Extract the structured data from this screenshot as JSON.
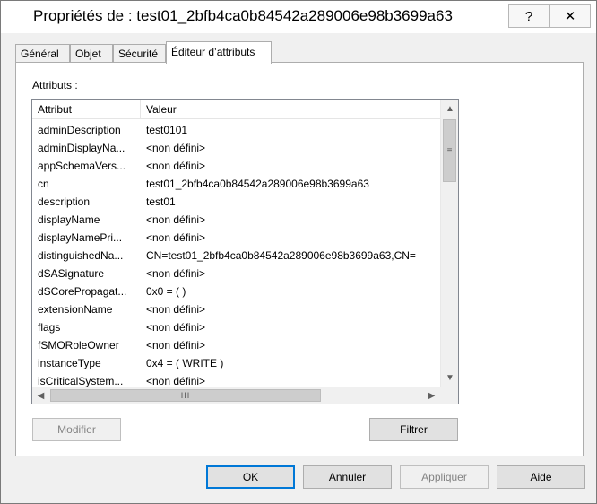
{
  "window": {
    "title": "Propriétés de : test01_2bfb4ca0b84542a289006e98b3699a63",
    "help_label": "?",
    "close_label": "✕"
  },
  "tabs": [
    {
      "label": "Général"
    },
    {
      "label": "Objet"
    },
    {
      "label": "Sécurité"
    },
    {
      "label": "Éditeur d’attributs",
      "active": true
    }
  ],
  "attributes": {
    "label": "Attributs :",
    "columns": [
      "Attribut",
      "Valeur"
    ],
    "rows": [
      {
        "name": "adminDescription",
        "value": "test0101"
      },
      {
        "name": "adminDisplayNa...",
        "value": "<non défini>"
      },
      {
        "name": "appSchemaVers...",
        "value": "<non défini>"
      },
      {
        "name": "cn",
        "value": "test01_2bfb4ca0b84542a289006e98b3699a63"
      },
      {
        "name": "description",
        "value": "test01"
      },
      {
        "name": "displayName",
        "value": "<non défini>"
      },
      {
        "name": "displayNamePri...",
        "value": "<non défini>"
      },
      {
        "name": "distinguishedNa...",
        "value": "CN=test01_2bfb4ca0b84542a289006e98b3699a63,CN="
      },
      {
        "name": "dSASignature",
        "value": "<non défini>"
      },
      {
        "name": "dSCorePropagat...",
        "value": "0x0 = ( )"
      },
      {
        "name": "extensionName",
        "value": "<non défini>"
      },
      {
        "name": "flags",
        "value": "<non défini>"
      },
      {
        "name": "fSMORoleOwner",
        "value": "<non défini>"
      },
      {
        "name": "instanceType",
        "value": "0x4 = ( WRITE )"
      },
      {
        "name": "isCriticalSystem...",
        "value": "<non défini>"
      }
    ]
  },
  "buttons": {
    "modifier": "Modifier",
    "filtrer": "Filtrer",
    "ok": "OK",
    "annuler": "Annuler",
    "appliquer": "Appliquer",
    "aide": "Aide"
  },
  "icons": {
    "scroll_up": "up-arrow-icon",
    "scroll_down": "down-arrow-icon",
    "scroll_left": "left-arrow-icon",
    "scroll_right": "right-arrow-icon"
  },
  "colors": {
    "default_button_border": "#0078d7",
    "window_background": "#f0f0f0"
  }
}
